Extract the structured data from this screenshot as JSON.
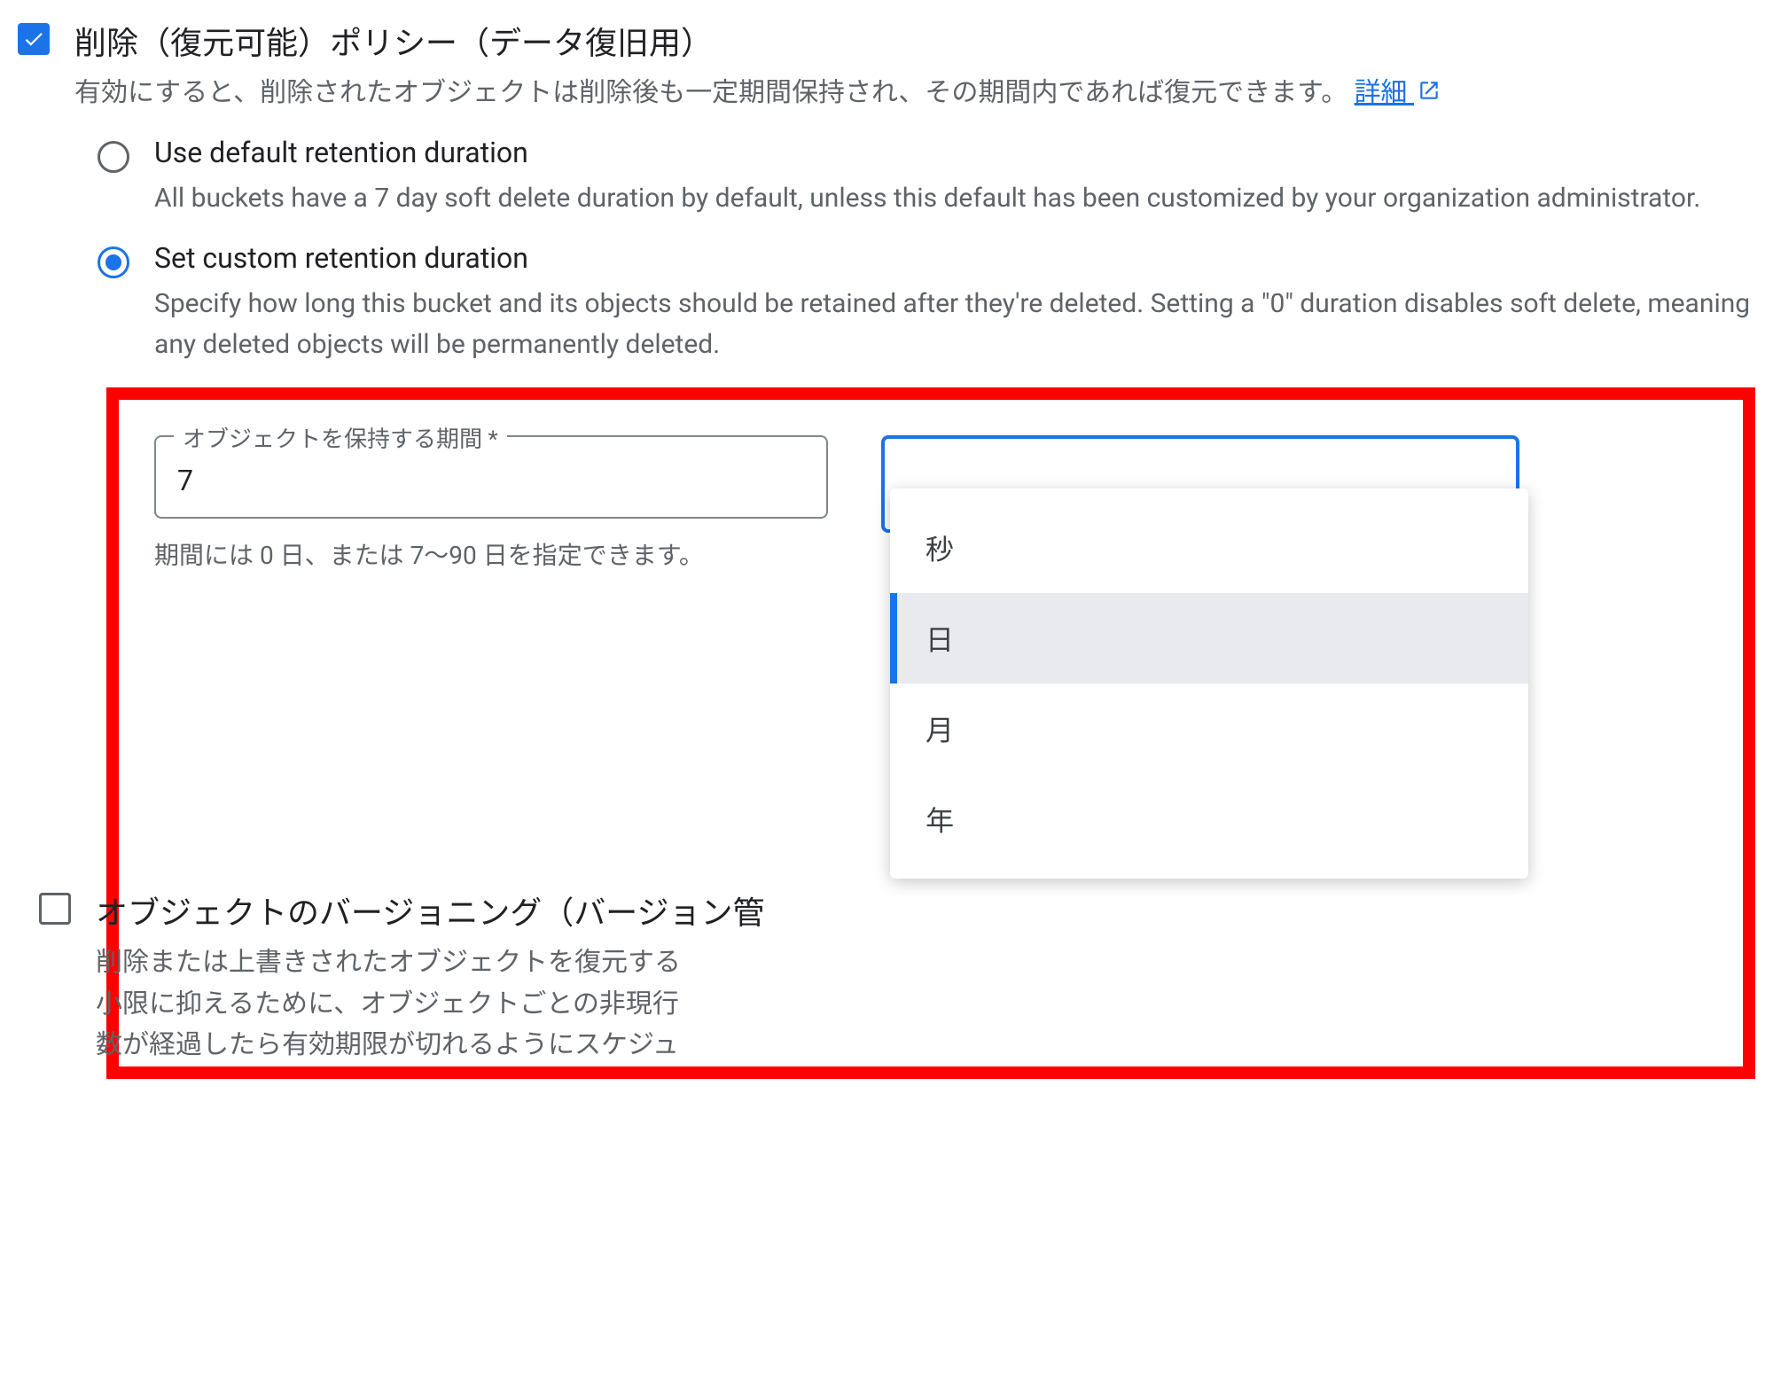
{
  "softDelete": {
    "title": "削除（復元可能）ポリシー（データ復旧用）",
    "desc": "有効にすると、削除されたオブジェクトは削除後も一定期間保持され、その期間内であれば復元できます。",
    "learnMore": "詳細"
  },
  "retentionOptions": {
    "default": {
      "label": "Use default retention duration",
      "desc": "All buckets have a 7 day soft delete duration by default, unless this default has been customized by your organization administrator."
    },
    "custom": {
      "label": "Set custom retention duration",
      "desc": "Specify how long this bucket and its objects should be retained after they're deleted. Setting a \"0\" duration disables soft delete, meaning any deleted objects will be permanently deleted."
    }
  },
  "durationField": {
    "label": "オブジェクトを保持する期間 *",
    "value": "7",
    "helper": "期間には 0 日、または 7～90 日を指定できます。"
  },
  "unitDropdown": {
    "options": [
      "秒",
      "日",
      "月",
      "年"
    ],
    "selected": "日"
  },
  "versioning": {
    "title": "オブジェクトのバージョニング（バージョン管",
    "descLine1": "削除または上書きされたオブジェクトを復元する",
    "descLine2": "小限に抑えるために、オブジェクトごとの非現行",
    "descLine3": "数が経過したら有効期限が切れるようにスケジュ"
  }
}
